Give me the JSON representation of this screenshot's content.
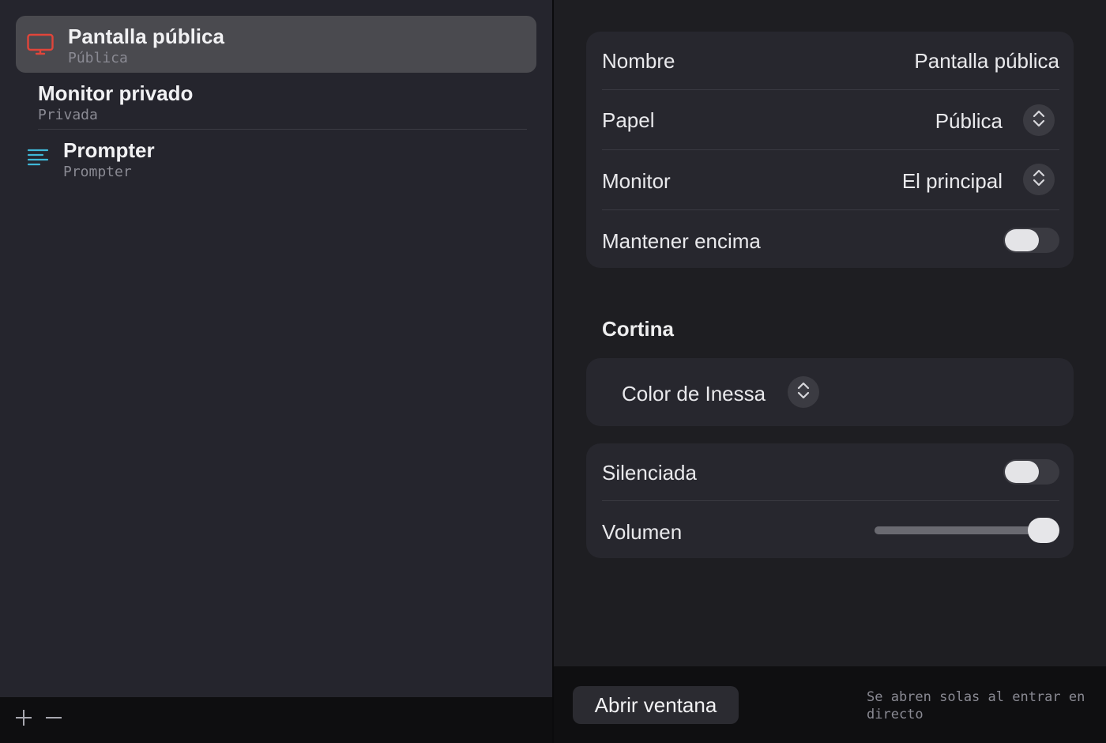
{
  "sidebar": {
    "items": [
      {
        "title": "Pantalla pública",
        "subtitle": "Pública",
        "icon": "monitor-icon",
        "icon_color": "#e0453a",
        "selected": true
      },
      {
        "title": "Monitor privado",
        "subtitle": "Privada",
        "icon": null,
        "selected": false
      },
      {
        "title": "Prompter",
        "subtitle": "Prompter",
        "icon": "text-lines-icon",
        "icon_color": "#3fb8d8",
        "selected": false
      }
    ],
    "footer": {
      "add_icon": "plus-icon",
      "remove_icon": "minus-icon"
    }
  },
  "detail": {
    "general": {
      "nombre_label": "Nombre",
      "nombre_value": "Pantalla pública",
      "papel_label": "Papel",
      "papel_value": "Pública",
      "monitor_label": "Monitor",
      "monitor_value": "El principal",
      "mantener_label": "Mantener encima",
      "mantener_on": false
    },
    "cortina": {
      "title": "Cortina",
      "color_value": "Color de Inessa"
    },
    "audio": {
      "silenciada_label": "Silenciada",
      "silenciada_on": false,
      "volumen_label": "Volumen",
      "volumen_fraction": 1.0
    }
  },
  "bottom": {
    "open_button": "Abrir ventana",
    "hint": "Se abren solas al entrar en directo"
  },
  "colors": {
    "background": "#1e1e22",
    "sidebar": "#25252d",
    "selected_row": "#4a4a4f",
    "card": "#27272e",
    "accent_red": "#e0453a",
    "accent_cyan": "#3fb8d8"
  }
}
